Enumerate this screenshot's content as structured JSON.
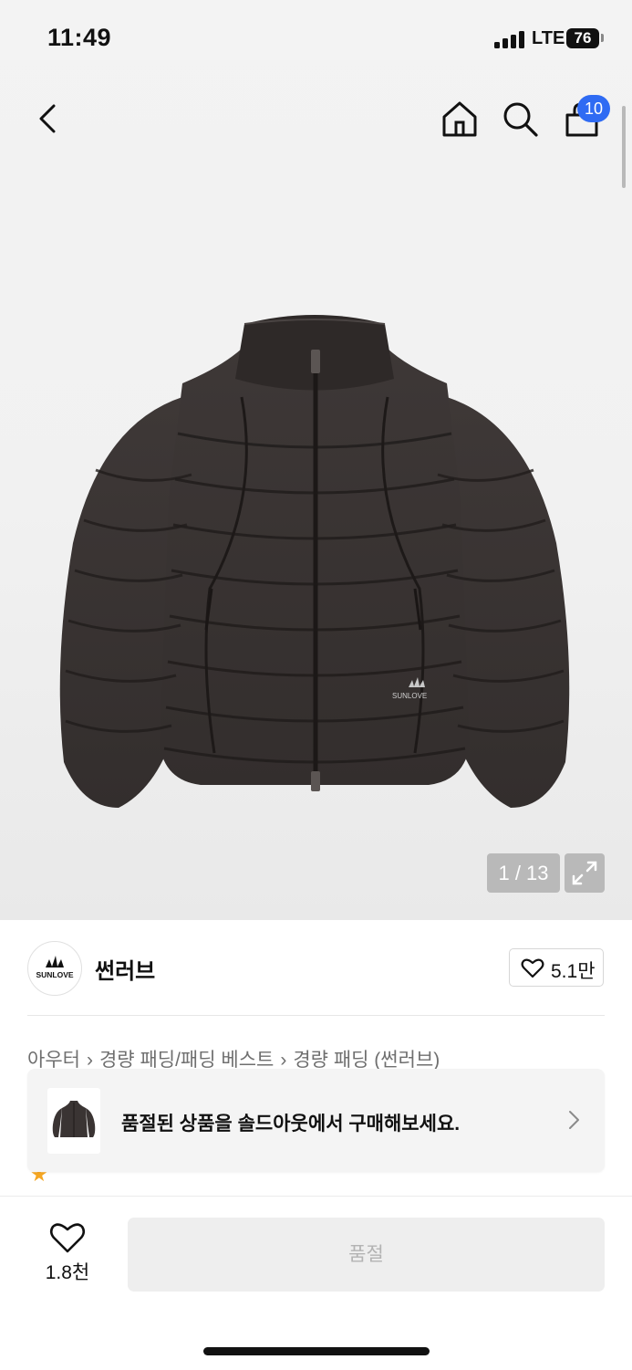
{
  "status": {
    "time": "11:49",
    "network": "LTE",
    "battery": "76"
  },
  "header": {
    "back_icon": "chevron-left-icon",
    "home_icon": "home-icon",
    "search_icon": "search-icon",
    "cart_icon": "shopping-bag-icon",
    "cart_count": "10"
  },
  "gallery": {
    "counter": "1 / 13",
    "expand_icon": "expand-icon",
    "jacket_logo_text": "SUNLOVE"
  },
  "brand": {
    "logo_text": "SUNLOVE",
    "name": "썬러브",
    "likes": "5.1만"
  },
  "breadcrumb": [
    "아우터",
    "경량 패딩/패딩 베스트",
    "경량 패딩 (썬러브)"
  ],
  "banner": {
    "text": "품절된 상품을 솔드아웃에서 구매해보세요."
  },
  "bottom": {
    "wish_count": "1.8천",
    "buy_label": "품절"
  },
  "colors": {
    "accent": "#2f6bf3",
    "jacket": "#3a3433",
    "disabled_text": "#b3b3b3"
  }
}
